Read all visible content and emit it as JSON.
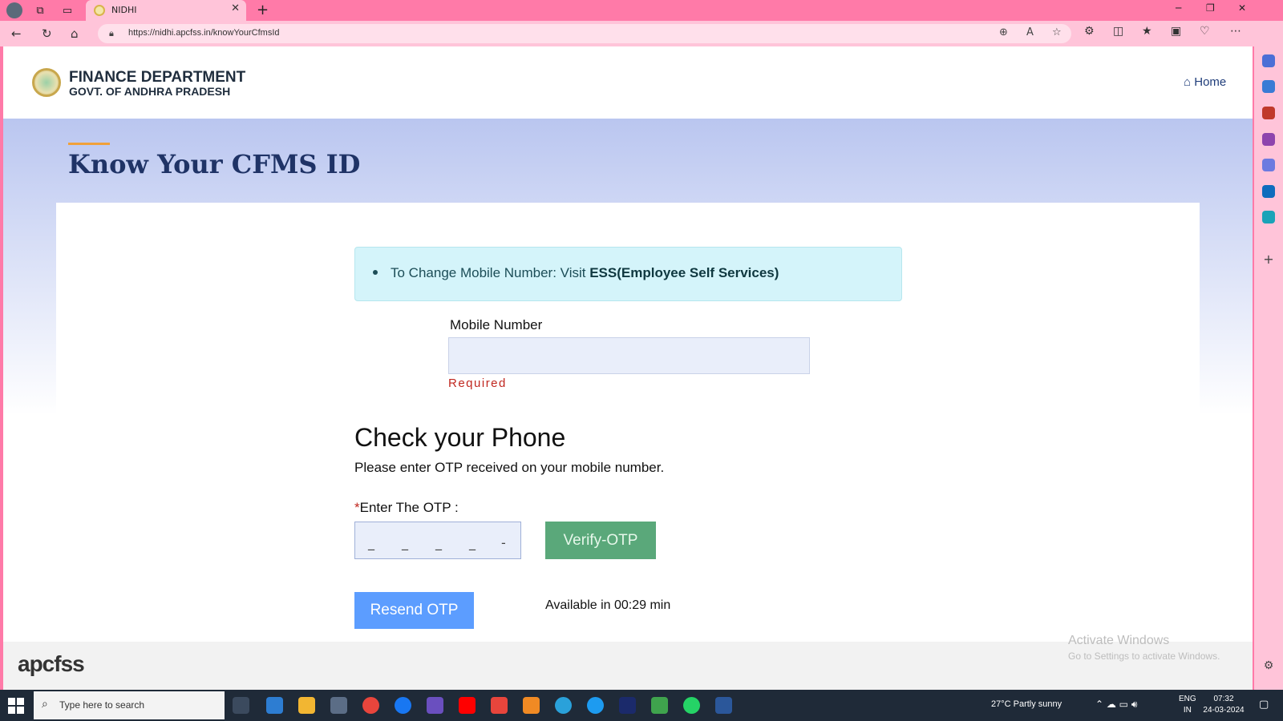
{
  "browser": {
    "tab_title": "NIDHI",
    "url": "https://nidhi.apcfss.in/knowYourCfmsId",
    "tab_close_glyph": "✕",
    "new_tab_glyph": "+"
  },
  "header": {
    "dept_line1": "FINANCE DEPARTMENT",
    "dept_line2": "GOVT. OF ANDHRA PRADESH",
    "home_label": "Home"
  },
  "page": {
    "title": "Know Your CFMS ID"
  },
  "alert": {
    "text": "To Change Mobile Number: Visit ",
    "bold": "ESS(Employee Self Services)"
  },
  "form": {
    "mobile_label": "Mobile Number",
    "mobile_value": "",
    "required_text": "Required",
    "check_heading": "Check your Phone",
    "check_sub": "Please enter OTP received on your mobile number.",
    "otp_required_mark": "*",
    "otp_label": "Enter The OTP :",
    "otp_slots": [
      "_",
      "_",
      "_",
      "_",
      "-"
    ],
    "verify_label": "Verify-OTP",
    "resend_label": "Resend OTP",
    "timer_text": "Available in 00:29 min"
  },
  "footer": {
    "logo_text": "apcfss"
  },
  "watermark": {
    "line1": "Activate Windows",
    "line2": "Go to Settings to activate Windows."
  },
  "taskbar": {
    "search_placeholder": "Type here to search",
    "weather": "27°C  Partly sunny",
    "lang_line1": "ENG",
    "lang_line2": "IN",
    "time": "07:32",
    "date": "24-03-2024"
  },
  "colors": {
    "title_bar": "#ff7aa8",
    "page_title": "#1f3366",
    "alert_bg": "#d4f4fa",
    "verify_btn": "#5aa87a",
    "resend_btn": "#5c9dff",
    "required": "#c0271f"
  }
}
